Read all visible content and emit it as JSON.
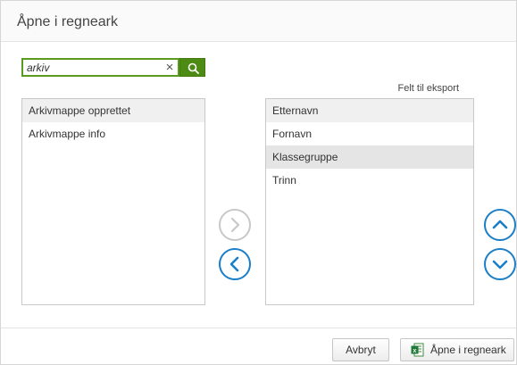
{
  "dialog": {
    "title": "Åpne i regneark"
  },
  "search": {
    "value": "arkiv",
    "clear_icon": "×",
    "icon": "search-icon"
  },
  "available_fields": {
    "items": [
      {
        "label": "Arkivmappe opprettet"
      },
      {
        "label": "Arkivmappe info"
      }
    ]
  },
  "export_fields": {
    "heading": "Felt til eksport",
    "items": [
      {
        "label": "Etternavn"
      },
      {
        "label": "Fornavn"
      },
      {
        "label": "Klassegruppe",
        "selected": true
      },
      {
        "label": "Trinn"
      }
    ]
  },
  "transfer_controls": {
    "add_icon": "chevron-right-icon",
    "add_enabled": false,
    "remove_icon": "chevron-left-icon",
    "remove_enabled": true
  },
  "order_controls": {
    "up_icon": "chevron-up-icon",
    "down_icon": "chevron-down-icon"
  },
  "footer": {
    "cancel_label": "Avbryt",
    "open_label": "Åpne i regneark",
    "open_icon": "excel-icon"
  },
  "colors": {
    "accent_blue": "#1a7fc8",
    "search_green": "#4d8b14",
    "disabled_gray": "#c8c8c8",
    "selected_row": "#e5e5e5"
  }
}
